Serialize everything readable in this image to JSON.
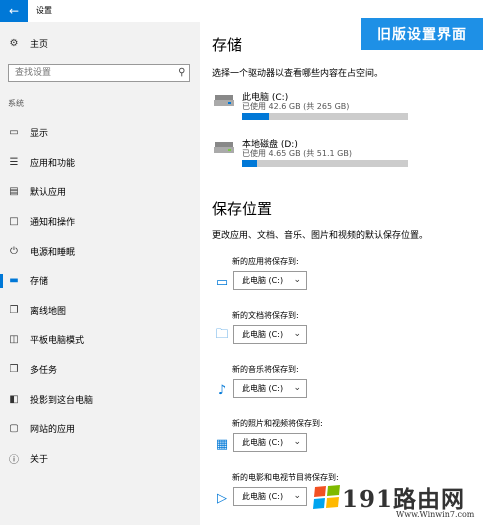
{
  "titlebar": {
    "back_icon": "back-arrow-icon",
    "title": "设置"
  },
  "sidebar": {
    "home_label": "主页",
    "search_placeholder": "查找设置",
    "section_label": "系统",
    "items": [
      {
        "label": "显示",
        "icon": "display-icon"
      },
      {
        "label": "应用和功能",
        "icon": "apps-features-icon"
      },
      {
        "label": "默认应用",
        "icon": "default-apps-icon"
      },
      {
        "label": "通知和操作",
        "icon": "notifications-icon"
      },
      {
        "label": "电源和睡眠",
        "icon": "power-icon"
      },
      {
        "label": "存储",
        "icon": "storage-icon",
        "active": true
      },
      {
        "label": "离线地图",
        "icon": "offline-maps-icon"
      },
      {
        "label": "平板电脑模式",
        "icon": "tablet-mode-icon"
      },
      {
        "label": "多任务",
        "icon": "multitasking-icon"
      },
      {
        "label": "投影到这台电脑",
        "icon": "project-icon"
      },
      {
        "label": "网站的应用",
        "icon": "apps-for-websites-icon"
      },
      {
        "label": "关于",
        "icon": "about-icon"
      }
    ]
  },
  "banner": "旧版设置界面",
  "storage": {
    "heading": "存储",
    "description": "选择一个驱动器以查看哪些内容在占空间。",
    "drives": [
      {
        "name": "此电脑 (C:)",
        "usage": "已使用 42.6 GB (共 265 GB)",
        "used_fraction": 0.16
      },
      {
        "name": "本地磁盘 (D:)",
        "usage": "已使用 4.65 GB (共 51.1 GB)",
        "used_fraction": 0.09
      }
    ]
  },
  "save_locations": {
    "heading": "保存位置",
    "description": "更改应用、文档、音乐、图片和视频的默认保存位置。",
    "items": [
      {
        "label": "新的应用将保存到:",
        "value": "此电脑 (C:)",
        "icon": "apps-monitor-icon"
      },
      {
        "label": "新的文档将保存到:",
        "value": "此电脑 (C:)",
        "icon": "folder-icon"
      },
      {
        "label": "新的音乐将保存到:",
        "value": "此电脑 (C:)",
        "icon": "music-note-icon"
      },
      {
        "label": "新的照片和视频将保存到:",
        "value": "此电脑 (C:)",
        "icon": "picture-icon"
      },
      {
        "label": "新的电影和电视节目将保存到:",
        "value": "此电脑 (C:)",
        "icon": "video-camera-icon"
      }
    ]
  },
  "watermark": {
    "text": "191路由网",
    "url": "Www.Winwin7.com"
  },
  "colors": {
    "accent": "#0078d7",
    "banner": "#1e90e6",
    "sidebar_bg": "#f2f2f2"
  }
}
